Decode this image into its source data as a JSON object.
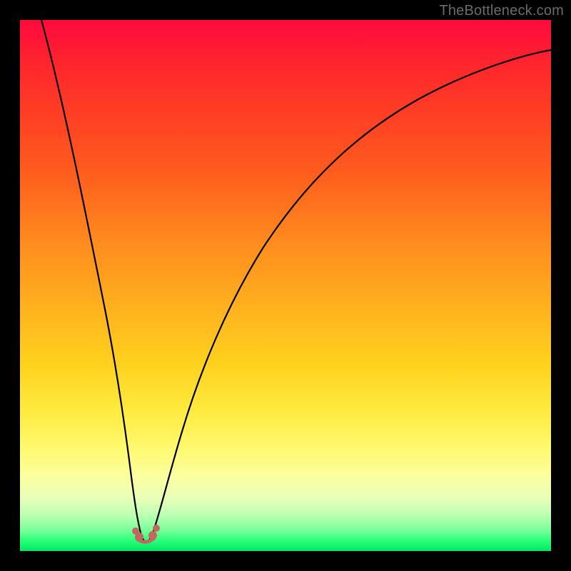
{
  "watermark": "TheBottleneck.com",
  "chart_data": {
    "type": "line",
    "title": "",
    "xlabel": "",
    "ylabel": "",
    "xlim": [
      0,
      100
    ],
    "ylim": [
      0,
      100
    ],
    "grid": false,
    "legend": false,
    "background_gradient": {
      "orientation": "vertical",
      "stops": [
        {
          "pos": 0,
          "color": "#ff0a3e"
        },
        {
          "pos": 28,
          "color": "#ff5a1e"
        },
        {
          "pos": 55,
          "color": "#ffb41e"
        },
        {
          "pos": 73,
          "color": "#ffe93c"
        },
        {
          "pos": 90,
          "color": "#e8ffb8"
        },
        {
          "pos": 100,
          "color": "#00e864"
        }
      ]
    },
    "series": [
      {
        "name": "bottleneck-curve",
        "color": "#000000",
        "x": [
          0,
          2,
          4,
          6,
          8,
          10,
          12,
          14,
          16,
          18,
          19,
          20,
          21,
          22,
          23,
          24,
          25,
          26,
          28,
          30,
          34,
          38,
          44,
          50,
          58,
          66,
          74,
          82,
          90,
          100
        ],
        "y": [
          100,
          90,
          80,
          70,
          60,
          50,
          41,
          32,
          22,
          12,
          8,
          4,
          2,
          1,
          1,
          2,
          4,
          7,
          14,
          22,
          35,
          46,
          58,
          66,
          74,
          80,
          84,
          87,
          89,
          91
        ]
      }
    ],
    "markers": [
      {
        "name": "vertex-left",
        "x": 20.5,
        "y": 3,
        "color": "#c06a5f"
      },
      {
        "name": "vertex-right",
        "x": 23.5,
        "y": 3,
        "color": "#c06a5f"
      }
    ],
    "notes": "y represents bottleneck percentage (higher = worse / red); curve reaches ~0 near x≈22 and rises asymptotically toward ~91 as x→100."
  }
}
